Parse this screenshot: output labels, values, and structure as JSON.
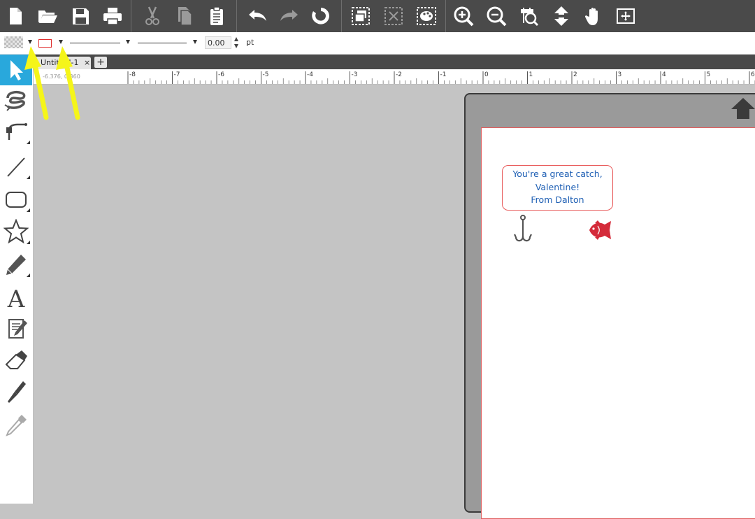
{
  "toolbar": {
    "buttons": [
      {
        "icon": "new-document-icon"
      },
      {
        "icon": "open-folder-icon"
      },
      {
        "icon": "save-icon"
      },
      {
        "icon": "print-icon"
      },
      {
        "icon": "cut-icon"
      },
      {
        "icon": "copy-icon"
      },
      {
        "icon": "paste-icon"
      },
      {
        "icon": "undo-icon"
      },
      {
        "icon": "redo-icon"
      },
      {
        "icon": "refresh-icon"
      },
      {
        "icon": "group-icon"
      },
      {
        "icon": "ungroup-icon"
      },
      {
        "icon": "palette-icon"
      },
      {
        "icon": "zoom-in-icon"
      },
      {
        "icon": "zoom-out-icon"
      },
      {
        "icon": "zoom-selection-icon"
      },
      {
        "icon": "move-icon"
      },
      {
        "icon": "pan-hand-icon"
      },
      {
        "icon": "fit-to-page-icon"
      }
    ],
    "background": "#4a4a4a"
  },
  "properties": {
    "fill_swatch": "transparent-pattern",
    "line_color": "#e03030",
    "line_weight": "0.00",
    "unit": "pt"
  },
  "tabs": {
    "document_tab": "Untitled-1",
    "close_glyph": "×",
    "add_glyph": "+"
  },
  "ruler": {
    "coordinates": "-6.376, 0.360",
    "labels": [
      "-8",
      "-7",
      "-6",
      "-5",
      "-4",
      "-3",
      "-2",
      "-1",
      "0",
      "1",
      "2",
      "3",
      "4",
      "5",
      "6"
    ]
  },
  "tools": [
    {
      "icon": "select-pointer-icon",
      "active": true
    },
    {
      "icon": "edit-points-icon"
    },
    {
      "icon": "curve-pen-icon"
    },
    {
      "icon": "line-tool-icon"
    },
    {
      "icon": "rounded-rectangle-icon"
    },
    {
      "icon": "star-shape-icon"
    },
    {
      "icon": "pencil-icon"
    },
    {
      "icon": "text-tool-icon"
    },
    {
      "icon": "text-edit-icon"
    },
    {
      "icon": "eraser-icon"
    },
    {
      "icon": "knife-icon"
    },
    {
      "icon": "eyedropper-icon"
    }
  ],
  "canvas": {
    "message_lines": [
      "You're a great catch,",
      "Valentine!",
      "From Dalton"
    ],
    "text_color": "#1e5fb4",
    "border_color": "#e85a5a",
    "fish_color": "#d42b3a",
    "hook_color": "#555555"
  },
  "annotations": {
    "arrow_color": "#f5f51a"
  }
}
